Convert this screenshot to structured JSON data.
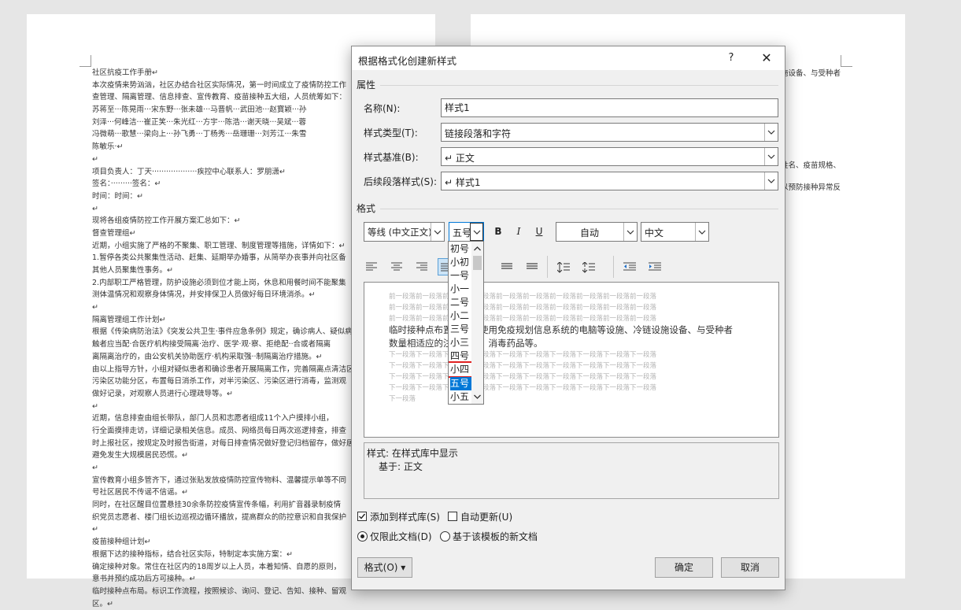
{
  "document": {
    "left_page_lines": [
      "社区抗疫工作手册↵",
      "本次疫情来势汹汹，社区办结合社区实际情况，第一时间成立了疫情防控工作",
      "查管理、隔离管理、信息排查、宣传教育、疫苗接种五大组，人员统筹如下：",
      "苏蒋至···陈晃雨···宋东野···张未雄···马晋帆···武田池···赵寶颖···孙",
      "刘泽···何峰洁···崔正笑···朱光红···方宇···陈浩···谢天晓···吴斌···蓉",
      "冯微萌···歌慧···梁向上···孙飞勇···丁杨秀···岳珊珊···刘芳江···朱雪",
      "陈敏乐·↵",
      "↵",
      "项目负责人：丁天···················疾控中心联系人：罗朋潇↵",
      "签名：·········签名：↵",
      "时间：时间：↵",
      "↵",
      "现将各组疫情防控工作开展方案汇总如下：↵",
      "督查管理组↵",
      "近期，小组实施了严格的不聚集、职工管理、制度管理等措施，详情如下：↵",
      "1.暂停各类公共聚集性活动、赶集、延期举办婚事，从简举办丧事并向社区备",
      "其他人员聚集性事务。↵",
      "2.内部职工严格管理，防护设施必须到位才能上岗，休息和用餐时间不能聚集",
      "测体温情况和观察身体情况，并安排保卫人员做好每日环境消杀。↵",
      "↵",
      "隔离管理组工作计划↵",
      "根据《传染病防治法》《突发公共卫生·事件应急条例》规定，确诊病人、疑似病",
      "触者应当配·合医疗机构接受隔离·治疗、医学·观·察、拒绝配··合或者隔离",
      "离隔离治疗的，由公安机关协助医疗·机构采取强··制隔离治疗措施。↵",
      "由以上指导方针，小组对疑似患者和确诊患者开展隔离工作，完善隔离点清洁区",
      "污染区功能分区，布置每日消杀工作，对半污染区、污染区进行消毒，监测观",
      "做好记录，对观察人员进行心理疏导等。↵",
      "↵",
      "近期，信息排查由组长带队，部门人员和志愿者组成11个入户摸排小组，",
      "行全面摸排走访，详细记录相关信息。成员、网络员每日两次巡逻排查，排查",
      "时上报社区，按规定及时报告街道，对每日排查情况做好登记归档留存，做好居",
      "避免发生大规模居民恐慌。↵",
      "↵",
      "宣传教育小组多管齐下，通过张贴发放疫情防控宣传物料、温馨提示单等不同",
      "号社区居民不传谣不信谣。↵",
      "同时，在社区醒目位置悬挂30余条防控疫情宣传条幅，利用扩音器录制疫情",
      "织党员志愿者、楼门组长边巡视边循环播放，提高群众的防控意识和自我保护",
      "↵",
      "疫苗接种组计划↵",
      "根据下达的接种指标，结合社区实际，特制定本实施方案：↵",
      "确定接种对象。常住在社区内的18周岁以上人员，本着知情、自愿的原则，",
      "意书并预约成功后方可接种。↵",
      "临时接种点布局。标识工作流程，按照候诊、询问、登记、告知、接种、留观",
      "区。↵"
    ],
    "right_page_lines": [
      "施设备、与受种者",
      "姓名、疫苗规格、",
      "以预防接种异常反"
    ]
  },
  "dialog": {
    "title": "根据格式化创建新样式",
    "help_glyph": "?",
    "close_glyph": "✕",
    "properties_label": "属性",
    "name_label": "名称(N):",
    "name_value": "样式1",
    "type_label": "样式类型(T):",
    "type_value": "链接段落和字符",
    "based_on_label": "样式基准(B):",
    "based_on_value": "↵ 正文",
    "next_style_label": "后续段落样式(S):",
    "next_style_value": "↵ 样式1",
    "format_label": "格式",
    "font_value": "等线 (中文正文)",
    "size_value": "五号",
    "bold": "B",
    "italic": "I",
    "underline": "U",
    "color_value": "自动",
    "script_value": "中文",
    "preview": {
      "prev_para_lines": [
        "前一段落前一段落前一段落前一段落前一段落前一段落前一段落前一段落前一段落前一段落",
        "前一段落前一段落前一段落前一段落前一段落前一段落前一段落前一段落前一段落前一段落",
        "前一段落前一段落前一段落前一段落前一段落前一段落前一段落前一段落前一段落前一段落"
      ],
      "sample_line1": "临时接种点布置：具有使用免疫规划信息系统的电脑等设施、冷链设施设备、与受种者",
      "sample_line2": "数量相适应的注射器材、消毒药品等。",
      "next_para_lines": [
        "下一段落下一段落下一段落下一段落下一段落下一段落下一段落下一段落下一段落下一段落",
        "下一段落下一段落下一段落下一段落下一段落下一段落下一段落下一段落下一段落下一段落",
        "下一段落下一段落下一段落下一段落下一段落下一段落下一段落下一段落下一段落下一段落",
        "下一段落下一段落下一段落下一段落下一段落下一段落下一段落下一段落下一段落下一段落",
        "下一段落"
      ]
    },
    "description_line1": "样式: 在样式库中显示",
    "description_line2": "基于: 正文",
    "add_to_gallery_label": "添加到样式库(S)",
    "add_to_gallery_checked": true,
    "auto_update_label": "自动更新(U)",
    "auto_update_checked": false,
    "only_this_doc_label": "仅限此文档(D)",
    "new_docs_label": "基于该模板的新文档",
    "selected_scope": "仅限此文档(D)",
    "format_button": "格式(O) ▾",
    "ok_button": "确定",
    "cancel_button": "取消"
  },
  "size_dropdown": {
    "options": [
      "初号",
      "小初",
      "一号",
      "小一",
      "二号",
      "小二",
      "三号",
      "小三",
      "四号",
      "小四",
      "五号",
      "小五"
    ],
    "selected": "五号",
    "highlighted": "小四"
  },
  "colors": {
    "selection_blue": "#0078d7",
    "highlight_red": "#e02020",
    "dialog_bg": "#f0f0f0"
  }
}
